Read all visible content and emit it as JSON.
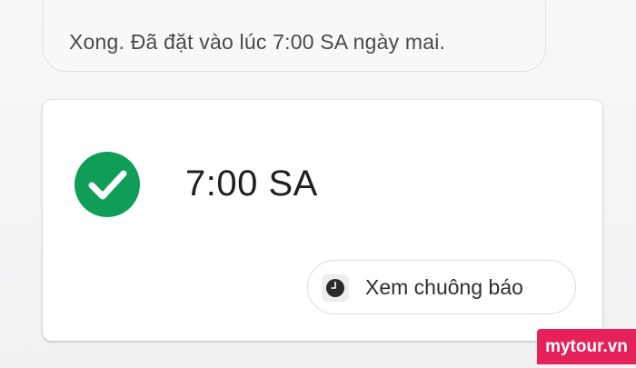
{
  "assistant_reply": {
    "text": "Xong. Đã đặt vào lúc 7:00 SA ngày mai."
  },
  "alarm_card": {
    "time": "7:00 SA",
    "status_icon": "check-circle-icon",
    "status_color": "#0f9d58",
    "action_button": {
      "label": "Xem chuông báo",
      "icon": "clock-icon"
    }
  },
  "watermark": {
    "text": "mytour.vn",
    "color": "#e5215a"
  }
}
